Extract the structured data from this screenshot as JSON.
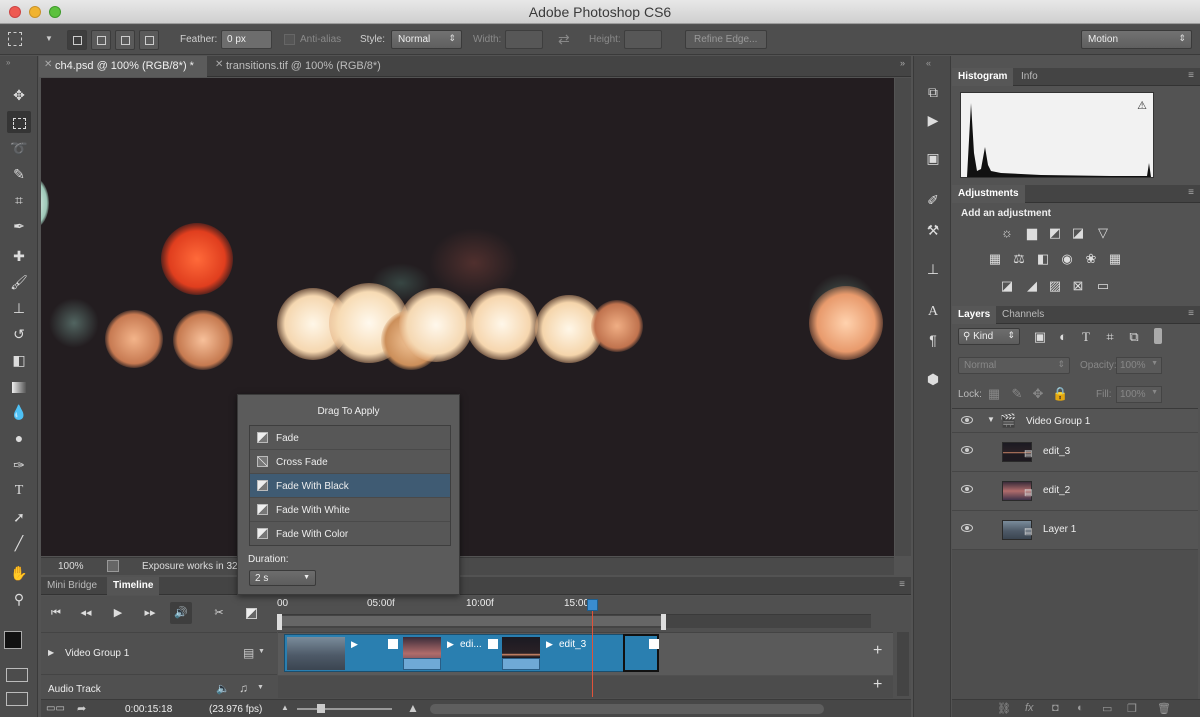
{
  "app": {
    "title": "Adobe Photoshop CS6"
  },
  "options_bar": {
    "feather_label": "Feather:",
    "feather_value": "0 px",
    "antialias_label": "Anti-alias",
    "style_label": "Style:",
    "style_value": "Normal",
    "width_label": "Width:",
    "height_label": "Height:",
    "refine_edge_label": "Refine Edge...",
    "workspace_value": "Motion"
  },
  "doc_tabs": [
    {
      "label": "ch4.psd @ 100% (RGB/8*) *",
      "active": true
    },
    {
      "label": "transitions.tif @ 100% (RGB/8*)",
      "active": false
    }
  ],
  "status_bar": {
    "zoom": "100%",
    "info": "Exposure works in 32"
  },
  "drag_popup": {
    "title": "Drag To Apply",
    "items": [
      "Fade",
      "Cross Fade",
      "Fade With Black",
      "Fade With White",
      "Fade With Color"
    ],
    "selected_index": 2,
    "duration_label": "Duration:",
    "duration_value": "2 s"
  },
  "timeline": {
    "tabs": [
      "Mini Bridge",
      "Timeline"
    ],
    "active_tab": "Timeline",
    "ruler": [
      "00",
      "05:00f",
      "10:00f",
      "15:00"
    ],
    "video_group_label": "Video Group 1",
    "audio_track_label": "Audio Track",
    "clips": [
      "edi...",
      "edit_3"
    ],
    "current_time": "0:00:15:18",
    "fps": "(23.976 fps)"
  },
  "histogram_panel": {
    "tabs": [
      "Histogram",
      "Info"
    ]
  },
  "adjustments_panel": {
    "tab": "Adjustments",
    "header": "Add an adjustment"
  },
  "layers_panel": {
    "tabs": [
      "Layers",
      "Channels"
    ],
    "filter_kind": "Kind",
    "blend_mode": "Normal",
    "opacity_label": "Opacity:",
    "opacity_value": "100%",
    "lock_label": "Lock:",
    "fill_label": "Fill:",
    "fill_value": "100%",
    "layers": [
      {
        "name": "Video Group 1",
        "type": "group"
      },
      {
        "name": "edit_3",
        "type": "video"
      },
      {
        "name": "edit_2",
        "type": "video"
      },
      {
        "name": "Layer 1",
        "type": "video"
      }
    ]
  },
  "colors": {
    "accent": "#2a7fb0",
    "selection": "#3f5b73",
    "playhead": "#e0533a"
  }
}
